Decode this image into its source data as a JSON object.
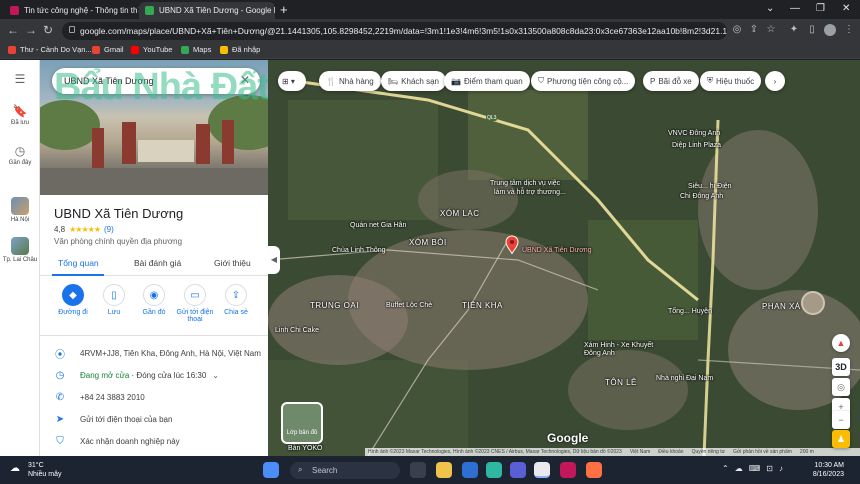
{
  "browser": {
    "tabs": [
      {
        "title": "Tin tức công nghệ - Thông tin th",
        "favicon_color": "#c2185b"
      },
      {
        "title": "UBND Xã Tiên Dương - Google M",
        "favicon_color": "#34a853"
      }
    ],
    "new_tab": "+",
    "url": "google.com/maps/place/UBND+Xã+Tiên+Dương/@21.1441305,105.8298452,2219m/data=!3m1!1e3!4m6!3m5!1s0x313500a808c8da23:0x3ce67363e12aa10b!8m2!3d21.1440308!4d105...",
    "bookmarks": [
      {
        "label": "Thư - Cành Do Vạn...",
        "color": "#ea4335"
      },
      {
        "label": "Gmail",
        "color": "#ea4335"
      },
      {
        "label": "YouTube",
        "color": "#ff0000"
      },
      {
        "label": "Maps",
        "color": "#34a853"
      },
      {
        "label": "Đã nhập",
        "color": "#fbbc04"
      }
    ]
  },
  "rail": {
    "menu_icon": "menu-icon",
    "items": [
      {
        "label": "Đã lưu"
      },
      {
        "label": "Gần đây"
      },
      {
        "label": "Hà Nội"
      },
      {
        "label": "Tp. Lai Châu"
      }
    ]
  },
  "panel": {
    "search_value": "UBND Xã Tiên Dương",
    "watermark": "Bẩu Nhà Đất",
    "place_name": "UBND Xã Tiên Dương",
    "rating": "4,8",
    "stars": "★★★★★",
    "review_count": "(9)",
    "place_type": "Văn phòng chính quyền địa phương",
    "tabs": [
      "Tổng quan",
      "Bài đánh giá",
      "Giới thiệu"
    ],
    "actions": [
      {
        "label": "Đường đi",
        "icon": "directions-icon"
      },
      {
        "label": "Lưu",
        "icon": "bookmark-icon"
      },
      {
        "label": "Gần đó",
        "icon": "nearby-icon"
      },
      {
        "label": "Gửi tới điện thoại",
        "icon": "phone-send-icon"
      },
      {
        "label": "Chia sẻ",
        "icon": "share-icon"
      }
    ],
    "address": "4RVM+JJ8, Tiên Kha, Đông Anh, Hà Nội, Việt Nam",
    "hours_status": "Đang mở cửa",
    "hours_detail": "· Đóng cửa lúc 16:30",
    "phone": "+84 24 3883 2010",
    "send_to_phone": "Gửi tới điện thoại của bạn",
    "verify_business": "Xác nhận doanh nghiệp này"
  },
  "map": {
    "chips": [
      {
        "label": "Nhà hàng",
        "icon": "restaurant-icon"
      },
      {
        "label": "Khách sạn",
        "icon": "hotel-icon"
      },
      {
        "label": "Điểm tham quan",
        "icon": "camera-icon"
      },
      {
        "label": "Phương tiện công cộ...",
        "icon": "transit-icon"
      },
      {
        "label": "Bãi đỗ xe",
        "icon": "parking-icon"
      },
      {
        "label": "Hiệu thuốc",
        "icon": "pharmacy-icon"
      }
    ],
    "labels": [
      {
        "text": "VNVC Đông Anh"
      },
      {
        "text": "Diệp Linh Plaza"
      },
      {
        "text": "Siêu... hị Điện"
      },
      {
        "text": "Chi Đông Anh"
      },
      {
        "text": "Trung tâm dịch vụ việc"
      },
      {
        "text": "làm và hỗ trợ thương..."
      },
      {
        "text": "XÓM LẠC"
      },
      {
        "text": "Quán net Gia Hân"
      },
      {
        "text": "XÓM BÒI"
      },
      {
        "text": "Chùa Linh Thông"
      },
      {
        "text": "UBND Xã Tiên Dương"
      },
      {
        "text": "TRUNG OAI"
      },
      {
        "text": "Buffet Lộc Chè"
      },
      {
        "text": "TIÊN KHA"
      },
      {
        "text": "Linh Chi Cake"
      },
      {
        "text": "PHAN XÁ"
      },
      {
        "text": "Xám Hinh - Xe Khuyết Đông Anh"
      },
      {
        "text": "TÔN LÊ"
      },
      {
        "text": "Nhà nghỉ Đại Nam"
      },
      {
        "text": "Tổng... Huyện"
      },
      {
        "text": "Bàn YOKO"
      }
    ],
    "layer_label": "Lớp bản đồ",
    "google_logo": "Google",
    "attribution": [
      "Hình ảnh ©2023 Maxar Technologies, Hình ảnh ©2023 CNES / Airbus, Maxar Technologies, Dữ liệu bản đồ ©2023",
      "Việt Nam",
      "Điều khoản",
      "Quyền riêng tư",
      "Gửi phản hồi về sản phẩm",
      "200 m"
    ],
    "controls": {
      "threed": "3D"
    },
    "road_labels": [
      "QL3"
    ]
  },
  "taskbar": {
    "weather_temp": "31°C",
    "weather_desc": "Nhiều mây",
    "search_label": "Search",
    "time": "10:30 AM",
    "date": "8/16/2023"
  }
}
